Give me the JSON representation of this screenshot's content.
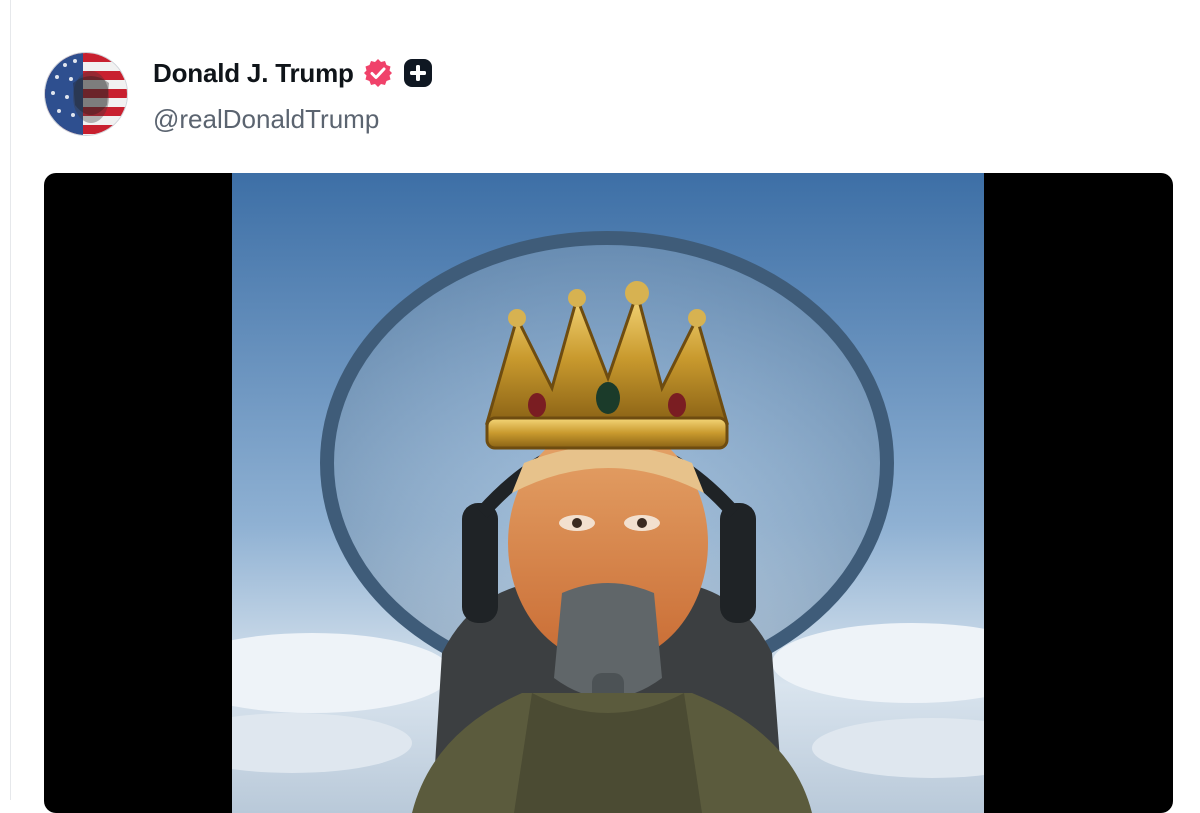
{
  "post": {
    "author": {
      "display_name": "Donald J. Trump",
      "handle": "@realDonaldTrump",
      "verified": true,
      "verified_color": "#f0426a",
      "subscriber_badge": true
    },
    "media": {
      "type": "image",
      "alt": "AI-generated image of a man wearing a gold crown and oxygen mask in a fighter jet cockpit"
    }
  }
}
